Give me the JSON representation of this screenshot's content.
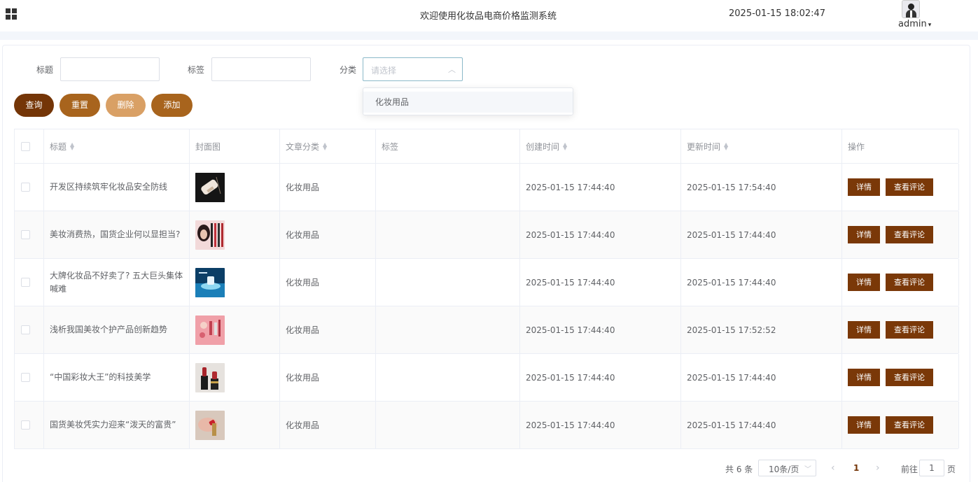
{
  "header": {
    "title": "欢迎使用化妆品电商价格监测系统",
    "time": "2025-01-15 18:02:47",
    "user": "admin",
    "caret": "▾"
  },
  "filters": {
    "title_label": "标题",
    "tag_label": "标签",
    "category_label": "分类",
    "category_placeholder": "请选择",
    "dropdown_options": [
      "化妆用品"
    ]
  },
  "toolbar": {
    "query": "查询",
    "reset": "重置",
    "delete": "删除",
    "add": "添加"
  },
  "colors": {
    "query": "#743507",
    "reset": "#a8641d",
    "delete": "#d9a065",
    "add": "#a8641d",
    "action": "#7a3808"
  },
  "table": {
    "columns": [
      "标题",
      "封面图",
      "文章分类",
      "标签",
      "创建时间",
      "更新时间",
      "操作"
    ],
    "actions": {
      "detail": "详情",
      "comments": "查看评论"
    },
    "rows": [
      {
        "title": "开发区持续筑牢化妆品安全防线",
        "category": "化妆用品",
        "tag": "",
        "created": "2025-01-15 17:44:40",
        "updated": "2025-01-15 17:54:40"
      },
      {
        "title": "美妆消费热，国货企业何以显担当?",
        "category": "化妆用品",
        "tag": "",
        "created": "2025-01-15 17:44:40",
        "updated": "2025-01-15 17:44:40"
      },
      {
        "title": "大牌化妆品不好卖了? 五大巨头集体喊难",
        "category": "化妆用品",
        "tag": "",
        "created": "2025-01-15 17:44:40",
        "updated": "2025-01-15 17:44:40"
      },
      {
        "title": "浅析我国美妆个护产品创新趋势",
        "category": "化妆用品",
        "tag": "",
        "created": "2025-01-15 17:44:40",
        "updated": "2025-01-15 17:52:52"
      },
      {
        "title": "“中国彩妆大王”的科技美学",
        "category": "化妆用品",
        "tag": "",
        "created": "2025-01-15 17:44:40",
        "updated": "2025-01-15 17:44:40"
      },
      {
        "title": "国货美妆凭实力迎来“泼天的富贵”",
        "category": "化妆用品",
        "tag": "",
        "created": "2025-01-15 17:44:40",
        "updated": "2025-01-15 17:44:40"
      }
    ]
  },
  "pagination": {
    "total": "共 6 条",
    "page_size": "10条/页",
    "prev": "‹",
    "current": "1",
    "next": "›",
    "goto_label": "前往",
    "goto_value": "1",
    "page_suffix": "页"
  }
}
